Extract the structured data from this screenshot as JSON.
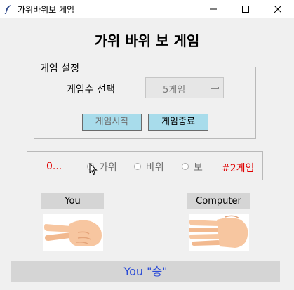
{
  "window": {
    "title": "가위바위보 게임",
    "app_icon": "feather-icon"
  },
  "main_title": "가위 바위 보 게임",
  "settings": {
    "legend": "게임 설정",
    "count_label": "게임수 선택",
    "count_value": "5게임",
    "start_button": "게임시작",
    "exit_button": "게임종료",
    "start_enabled": false
  },
  "choices": {
    "score": "0...",
    "options": [
      {
        "label": "가위",
        "selected": false
      },
      {
        "label": "바위",
        "selected": false
      },
      {
        "label": "보",
        "selected": false
      }
    ],
    "round": "#2게임"
  },
  "players": {
    "you": "You",
    "computer": "Computer",
    "you_hand": "scissors-hand-icon",
    "computer_hand": "paper-hand-icon"
  },
  "result": "You \"승\"",
  "colors": {
    "accent_red": "#e00000",
    "result_blue": "#2a4bd7",
    "button_blue": "#a8dceb"
  }
}
